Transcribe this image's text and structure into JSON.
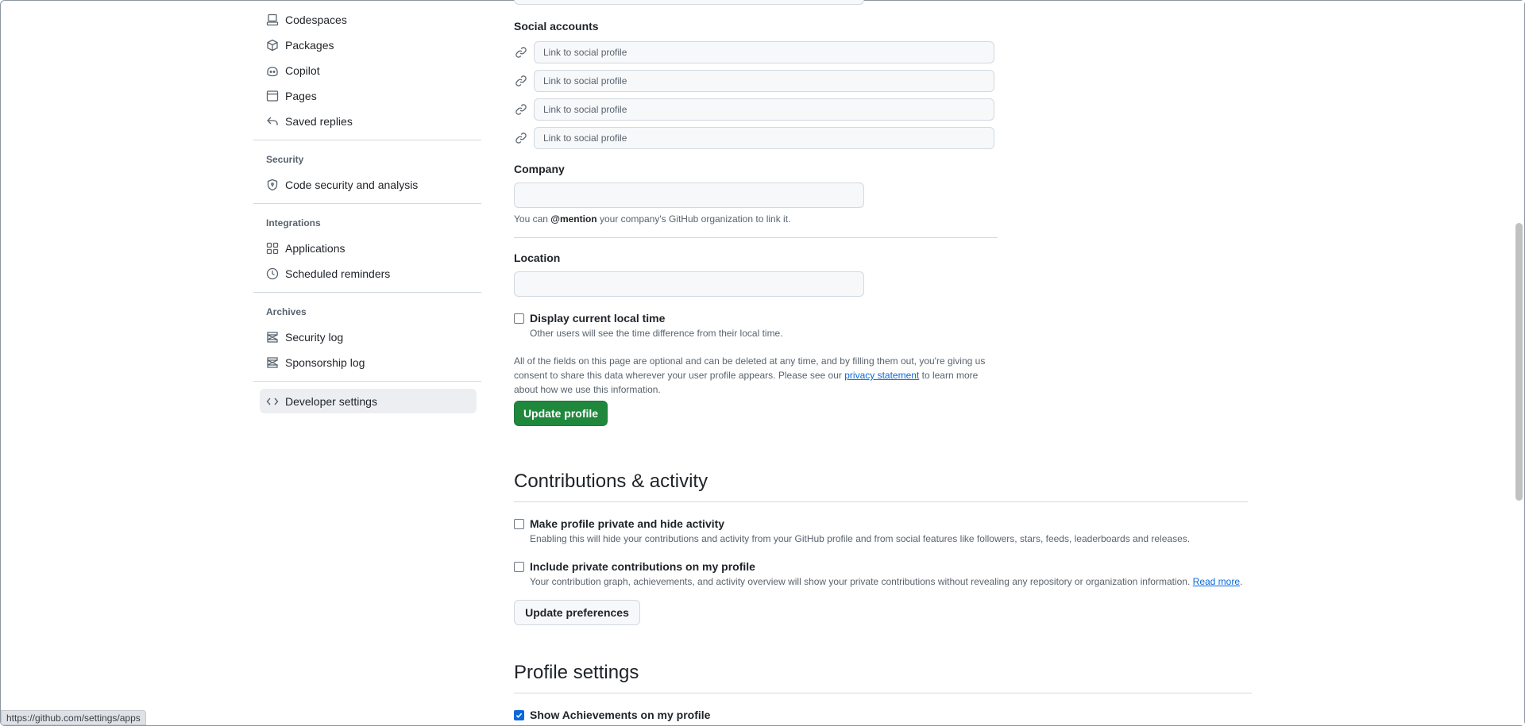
{
  "sidebar": {
    "items_top": [
      {
        "label": "Codespaces",
        "icon": "codespaces-icon"
      },
      {
        "label": "Packages",
        "icon": "package-icon"
      },
      {
        "label": "Copilot",
        "icon": "copilot-icon"
      },
      {
        "label": "Pages",
        "icon": "browser-icon"
      },
      {
        "label": "Saved replies",
        "icon": "reply-icon"
      }
    ],
    "security": {
      "heading": "Security",
      "items": [
        {
          "label": "Code security and analysis",
          "icon": "shield-lock-icon"
        }
      ]
    },
    "integrations": {
      "heading": "Integrations",
      "items": [
        {
          "label": "Applications",
          "icon": "apps-icon"
        },
        {
          "label": "Scheduled reminders",
          "icon": "clock-icon"
        }
      ]
    },
    "archives": {
      "heading": "Archives",
      "items": [
        {
          "label": "Security log",
          "icon": "log-icon"
        },
        {
          "label": "Sponsorship log",
          "icon": "log-icon"
        }
      ]
    },
    "developer": {
      "label": "Developer settings",
      "icon": "code-icon",
      "active": true
    }
  },
  "profile": {
    "social": {
      "label": "Social accounts",
      "placeholder": "Link to social profile",
      "count": 4
    },
    "company": {
      "label": "Company",
      "value": "",
      "note_prefix": "You can ",
      "note_mention": "@mention",
      "note_suffix": " your company's GitHub organization to link it."
    },
    "location": {
      "label": "Location",
      "value": ""
    },
    "local_time": {
      "label": "Display current local time",
      "checked": false,
      "note": "Other users will see the time difference from their local time."
    },
    "disclaimer": {
      "line1": "All of the fields on this page are optional and can be deleted at any time, and by filling them out, you're giving us",
      "line2_prefix": "consent to share this data wherever your user profile appears. Please see our ",
      "line2_link": "privacy statement",
      "line2_suffix": " to learn more",
      "line3": "about how we use this information."
    },
    "update_button": "Update profile"
  },
  "contributions": {
    "heading": "Contributions & activity",
    "private": {
      "label": "Make profile private and hide activity",
      "checked": false,
      "note": "Enabling this will hide your contributions and activity from your GitHub profile and from social features like followers, stars, feeds, leaderboards and releases."
    },
    "include_private": {
      "label": "Include private contributions on my profile",
      "checked": false,
      "note": "Your contribution graph, achievements, and activity overview will show your private contributions without revealing any repository or organization information. ",
      "link": "Read more",
      "link_suffix": "."
    },
    "update_button": "Update preferences"
  },
  "profile_settings": {
    "heading": "Profile settings",
    "achievements": {
      "label": "Show Achievements on my profile",
      "checked": true
    }
  },
  "status_url": "https://github.com/settings/apps",
  "colors": {
    "primary_button": "#1f883d",
    "link": "#0969da",
    "active_nav": "#eceef1"
  }
}
